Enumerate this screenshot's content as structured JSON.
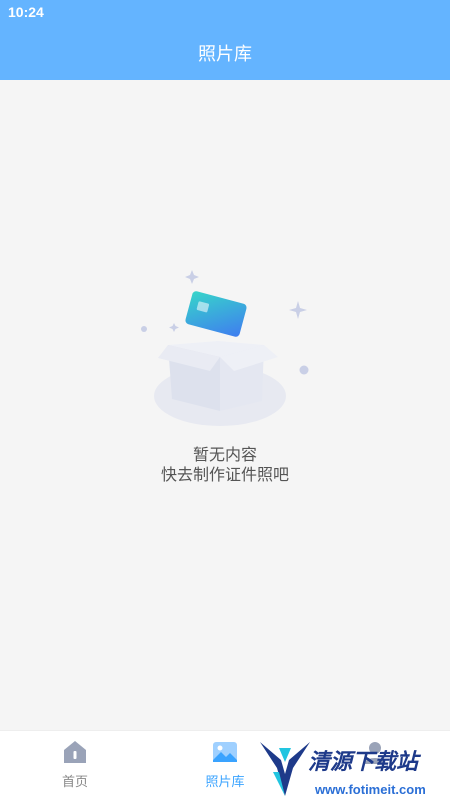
{
  "status_bar": {
    "time": "10:24"
  },
  "header": {
    "title": "照片库"
  },
  "empty_state": {
    "title": "暂无内容",
    "subtitle": "快去制作证件照吧",
    "illustration_icon": "empty-box-with-card-icon"
  },
  "tabbar": {
    "tabs": [
      {
        "label": "首页",
        "icon": "home-icon",
        "active": false
      },
      {
        "label": "照片库",
        "icon": "gallery-icon",
        "active": true
      },
      {
        "label": "",
        "icon": "profile-icon",
        "active": false
      }
    ]
  },
  "watermark": {
    "brand": "清源下载站",
    "url": "www.fotimeit.com"
  },
  "colors": {
    "header": "#64b4ff",
    "active_tab": "#3aa3ff",
    "inactive_tab": "#888888"
  }
}
